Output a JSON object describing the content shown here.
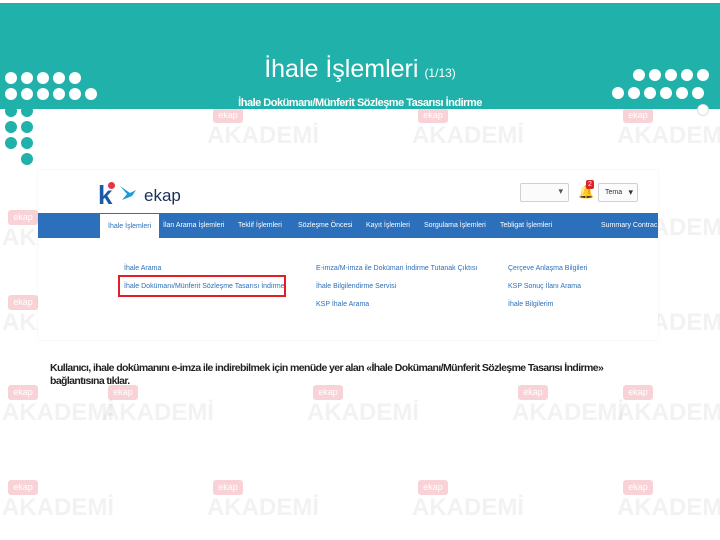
{
  "slide": {
    "title": "İhale İşlemleri",
    "counter": "(1/13)",
    "subtitle": "İhale Dokümanı/Münferit Sözleşme Tasarısı İndirme",
    "caption": "Kullanıcı, ihale dokümanını e-imza ile indirebilmek için menüde yer alan «İhale Dokümanı/Münferit Sözleşme Tasarısı İndirme» bağlantısına tıklar.",
    "header_color": "#20b2aa",
    "highlight_color": "#e31e24"
  },
  "watermark": {
    "tag": "ekap",
    "word": "AKADEMİ"
  },
  "screenshot": {
    "logo_text": "ekap",
    "notification_count": "2",
    "theme_label": "Tema",
    "nav": [
      {
        "label": "İhale İşlemleri"
      },
      {
        "label": "İlan Arama İşlemleri"
      },
      {
        "label": "Teklif İşlemleri"
      },
      {
        "label": "Sözleşme Öncesi"
      },
      {
        "label": "Kayıt İşlemleri"
      },
      {
        "label": "Sorgulama İşlemleri"
      },
      {
        "label": "Tebligat İşlemleri"
      },
      {
        "label": "Summary Contrac"
      }
    ],
    "menu": {
      "col1": [
        "İhale Arama",
        "İhale Dokümanı/Münferit Sözleşme Tasarısı İndirme"
      ],
      "col2": [
        "E-imza/M-imza ile Doküman İndirme Tutanak Çıktısı",
        "İhale Bilgilendirme Servisi",
        "KSP İhale Arama"
      ],
      "col3": [
        "Çerçeve Anlaşma Bilgileri",
        "KSP Sonuç İlanı Arama",
        "İhale Bilgilerim"
      ]
    },
    "nav_color": "#2c6fba"
  }
}
